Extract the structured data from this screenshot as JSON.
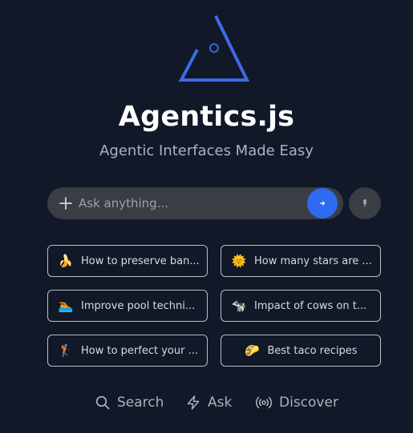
{
  "brand": {
    "title": "Agentics.js",
    "subtitle": "Agentic Interfaces Made Easy",
    "accent": "#3d6ae8"
  },
  "search": {
    "placeholder": "Ask anything...",
    "value": ""
  },
  "suggestions": [
    {
      "emoji": "🍌",
      "label": "How to preserve ban..."
    },
    {
      "emoji": "🌞",
      "label": "How many stars are ..."
    },
    {
      "emoji": "🏊",
      "label": "Improve pool techni..."
    },
    {
      "emoji": "🐄",
      "label": "Impact of cows on t..."
    },
    {
      "emoji": "🏌",
      "label": "How to perfect your ..."
    },
    {
      "emoji": "🌮",
      "label": "Best taco recipes"
    }
  ],
  "nav": {
    "search_label": "Search",
    "ask_label": "Ask",
    "discover_label": "Discover"
  },
  "icons": {
    "logo": "triangle-logo-icon",
    "add": "plus-icon",
    "send": "arrow-right-icon",
    "voice": "microphone-icon",
    "search": "magnifier-icon",
    "ask": "lightning-icon",
    "discover": "broadcast-icon"
  }
}
